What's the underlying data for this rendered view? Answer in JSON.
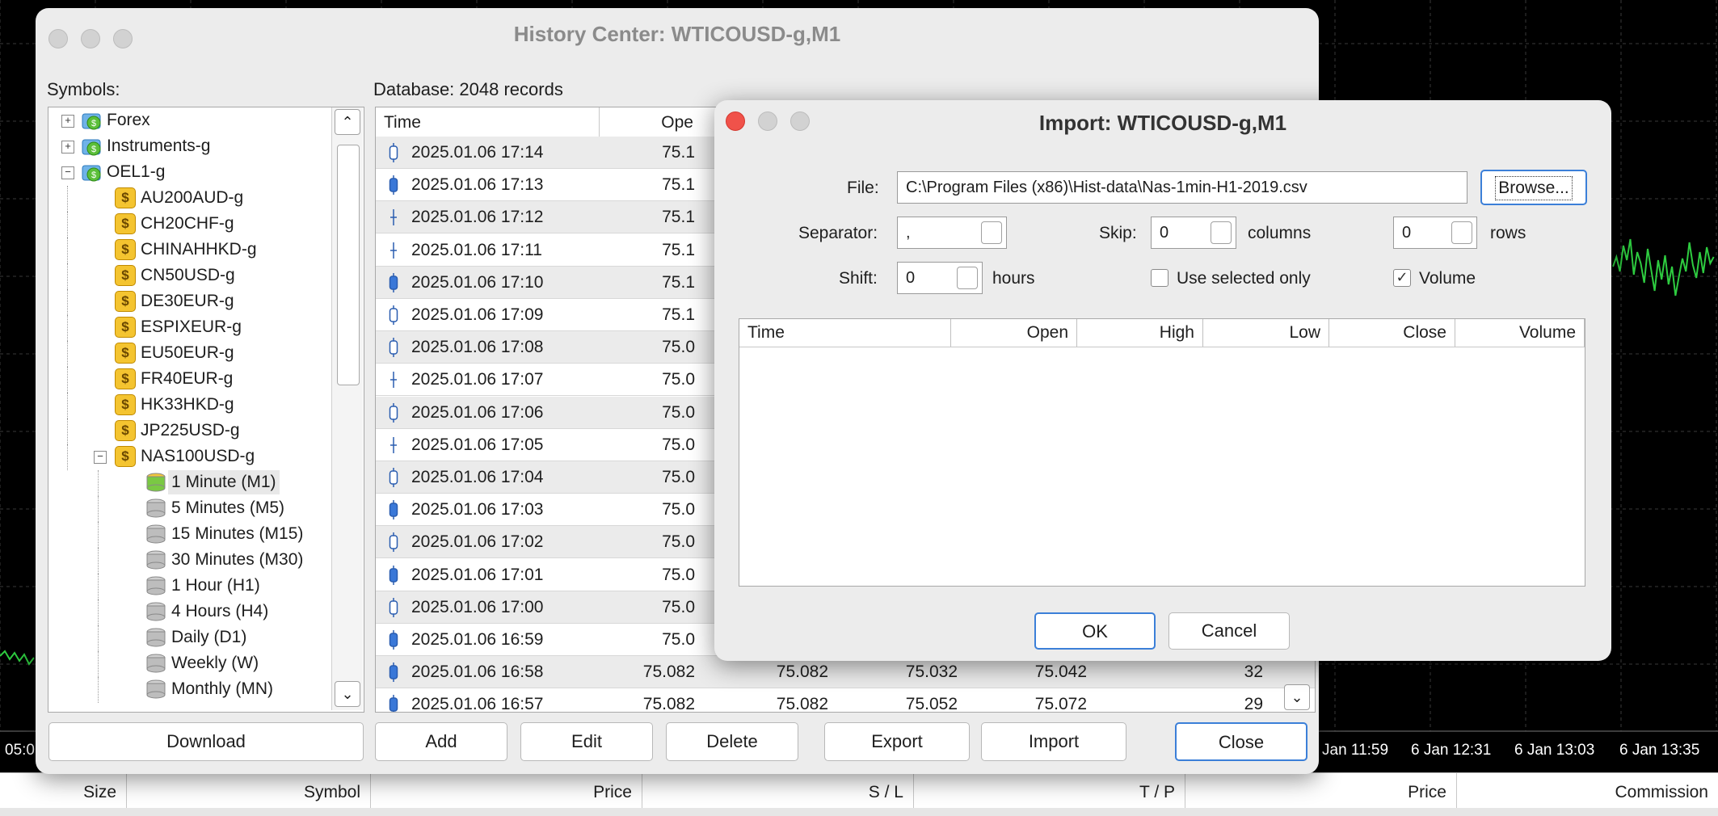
{
  "chart": {
    "time_labels": [
      "05:0",
      "Jan 11:59",
      "6 Jan 12:31",
      "6 Jan 13:03",
      "6 Jan 13:35"
    ],
    "colors": {
      "background": "#000000",
      "grid": "#3a3a3a",
      "line": "#2ecc40",
      "text": "#ffffff"
    }
  },
  "terminal": {
    "columns": [
      "Size",
      "Symbol",
      "Price",
      "S / L",
      "T / P",
      "Price",
      "Commission"
    ]
  },
  "history_center": {
    "title": "History Center: WTICOUSD-g,M1",
    "symbols_label": "Symbols:",
    "database_label": "Database: 2048 records",
    "tree": [
      {
        "label": "Forex",
        "type": "folder",
        "level": 0,
        "expander": "+"
      },
      {
        "label": "Instruments-g",
        "type": "folder",
        "level": 0,
        "expander": "+"
      },
      {
        "label": "OEL1-g",
        "type": "folder",
        "level": 0,
        "expander": "−"
      },
      {
        "label": "AU200AUD-g",
        "type": "symbol",
        "level": 1
      },
      {
        "label": "CH20CHF-g",
        "type": "symbol",
        "level": 1
      },
      {
        "label": "CHINAHHKD-g",
        "type": "symbol",
        "level": 1
      },
      {
        "label": "CN50USD-g",
        "type": "symbol",
        "level": 1
      },
      {
        "label": "DE30EUR-g",
        "type": "symbol",
        "level": 1
      },
      {
        "label": "ESPIXEUR-g",
        "type": "symbol",
        "level": 1
      },
      {
        "label": "EU50EUR-g",
        "type": "symbol",
        "level": 1
      },
      {
        "label": "FR40EUR-g",
        "type": "symbol",
        "level": 1
      },
      {
        "label": "HK33HKD-g",
        "type": "symbol",
        "level": 1
      },
      {
        "label": "JP225USD-g",
        "type": "symbol",
        "level": 1
      },
      {
        "label": "NAS100USD-g",
        "type": "symbol",
        "level": 1,
        "expander": "−"
      },
      {
        "label": "1 Minute (M1)",
        "type": "timeframe",
        "level": 2,
        "selected": true
      },
      {
        "label": "5 Minutes (M5)",
        "type": "timeframe",
        "level": 2
      },
      {
        "label": "15 Minutes (M15)",
        "type": "timeframe",
        "level": 2
      },
      {
        "label": "30 Minutes (M30)",
        "type": "timeframe",
        "level": 2
      },
      {
        "label": "1 Hour (H1)",
        "type": "timeframe",
        "level": 2
      },
      {
        "label": "4 Hours (H4)",
        "type": "timeframe",
        "level": 2
      },
      {
        "label": "Daily (D1)",
        "type": "timeframe",
        "level": 2
      },
      {
        "label": "Weekly (W)",
        "type": "timeframe",
        "level": 2
      },
      {
        "label": "Monthly (MN)",
        "type": "timeframe",
        "level": 2
      }
    ],
    "grid_headers": [
      "Time",
      "Ope"
    ],
    "rows": [
      {
        "time": "2025.01.06 17:14",
        "open": "75.1",
        "candle": "hollow"
      },
      {
        "time": "2025.01.06 17:13",
        "open": "75.1",
        "candle": "filled"
      },
      {
        "time": "2025.01.06 17:12",
        "open": "75.1",
        "candle": "cross"
      },
      {
        "time": "2025.01.06 17:11",
        "open": "75.1",
        "candle": "cross"
      },
      {
        "time": "2025.01.06 17:10",
        "open": "75.1",
        "candle": "filled"
      },
      {
        "time": "2025.01.06 17:09",
        "open": "75.1",
        "candle": "hollow"
      },
      {
        "time": "2025.01.06 17:08",
        "open": "75.0",
        "candle": "hollow"
      },
      {
        "time": "2025.01.06 17:07",
        "open": "75.0",
        "candle": "cross"
      },
      {
        "time": "2025.01.06 17:06",
        "open": "75.0",
        "candle": "hollow"
      },
      {
        "time": "2025.01.06 17:05",
        "open": "75.0",
        "candle": "cross"
      },
      {
        "time": "2025.01.06 17:04",
        "open": "75.0",
        "candle": "hollow"
      },
      {
        "time": "2025.01.06 17:03",
        "open": "75.0",
        "candle": "filled"
      },
      {
        "time": "2025.01.06 17:02",
        "open": "75.0",
        "candle": "hollow"
      },
      {
        "time": "2025.01.06 17:01",
        "open": "75.0",
        "candle": "filled"
      },
      {
        "time": "2025.01.06 17:00",
        "open": "75.0",
        "candle": "hollow"
      },
      {
        "time": "2025.01.06 16:59",
        "open": "75.0",
        "candle": "filled"
      },
      {
        "time": "2025.01.06 16:58",
        "open": "75.082",
        "high": "75.082",
        "low": "75.032",
        "close": "75.042",
        "volume": "32",
        "candle": "filled"
      },
      {
        "time": "2025.01.06 16:57",
        "open": "75.082",
        "high": "75.082",
        "low": "75.052",
        "close": "75.072",
        "volume": "29",
        "candle": "filled"
      }
    ],
    "buttons": {
      "download": "Download",
      "add": "Add",
      "edit": "Edit",
      "delete": "Delete",
      "export": "Export",
      "import": "Import",
      "close": "Close"
    }
  },
  "import_dialog": {
    "title": "Import: WTICOUSD-g,M1",
    "file_label": "File:",
    "file_value": "C:\\Program Files (x86)\\Hist-data\\Nas-1min-H1-2019.csv",
    "browse_label": "Browse...",
    "separator_label": "Separator:",
    "separator_value": ",",
    "skip_label": "Skip:",
    "skip_columns_value": "0",
    "columns_label": "columns",
    "skip_rows_value": "0",
    "rows_label": "rows",
    "shift_label": "Shift:",
    "shift_value": "0",
    "hours_label": "hours",
    "use_selected_label": "Use selected only",
    "use_selected_checked": false,
    "volume_label": "Volume",
    "volume_checked": true,
    "preview_headers": [
      "Time",
      "Open",
      "High",
      "Low",
      "Close",
      "Volume"
    ],
    "ok_label": "OK",
    "cancel_label": "Cancel"
  }
}
